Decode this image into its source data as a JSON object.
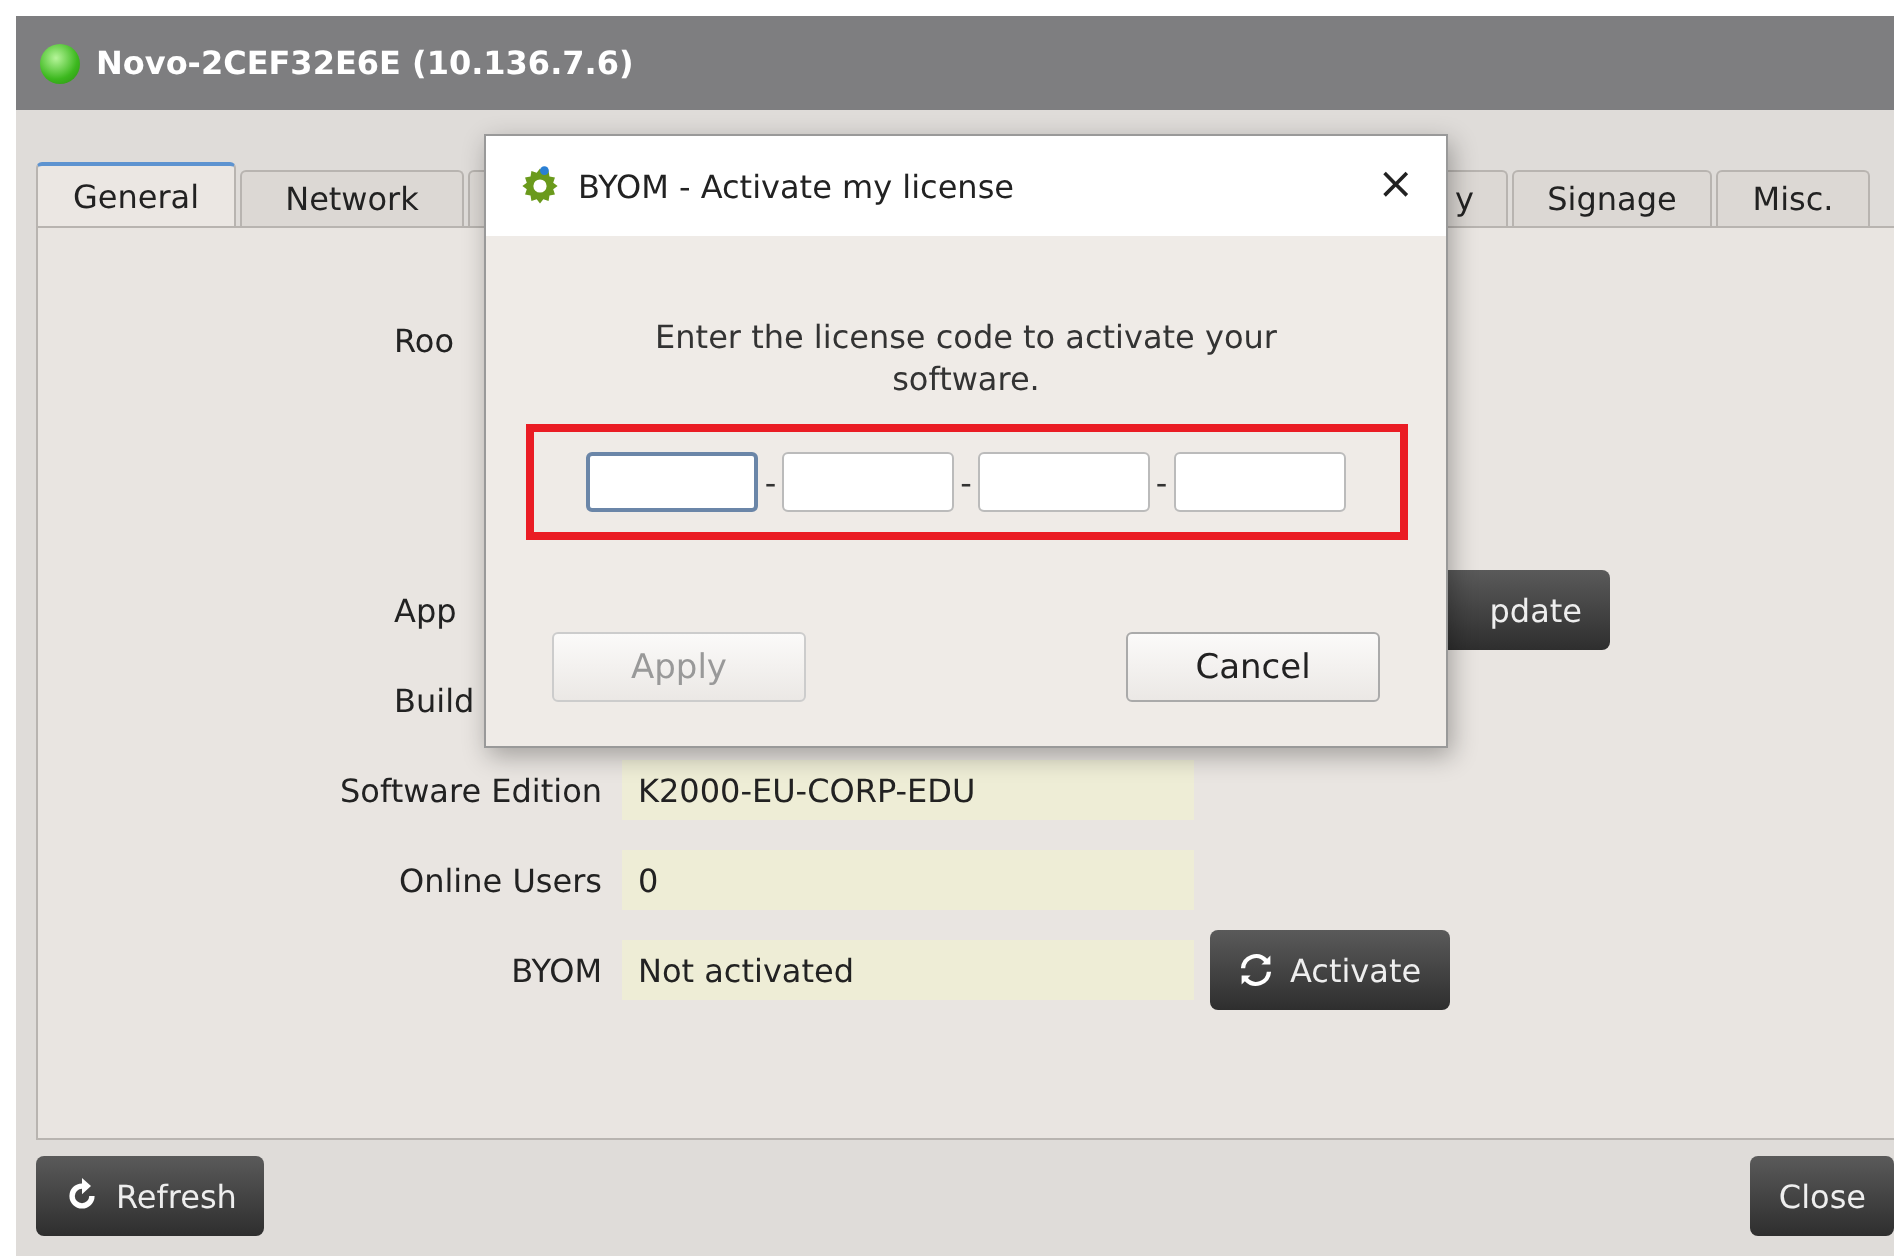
{
  "window": {
    "title": "Novo-2CEF32E6E (10.136.7.6)"
  },
  "tabs": [
    {
      "label": "General",
      "selected": true
    },
    {
      "label": "Network",
      "selected": false
    },
    {
      "label": "y",
      "selected": false
    },
    {
      "label": "Signage",
      "selected": false
    },
    {
      "label": "Misc.",
      "selected": false
    }
  ],
  "form": {
    "rows": [
      {
        "kind": "cut",
        "label": "Roo"
      },
      {
        "kind": "hidden"
      },
      {
        "kind": "hidden"
      },
      {
        "kind": "cut",
        "label": "App",
        "button": "pdate"
      },
      {
        "kind": "cut",
        "label": "Build"
      },
      {
        "kind": "full",
        "label": "Software Edition",
        "value": "K2000-EU-CORP-EDU"
      },
      {
        "kind": "full",
        "label": "Online Users",
        "value": "0"
      },
      {
        "kind": "full",
        "label": "BYOM",
        "value": "Not activated",
        "button": "Activate"
      }
    ]
  },
  "footer": {
    "refresh": "Refresh",
    "close": "Close"
  },
  "dialog": {
    "title": "BYOM - Activate my license",
    "close": "×",
    "message": "Enter the license code to activate your software.",
    "code_fields": [
      {
        "focused": true
      },
      {
        "focused": false
      },
      {
        "focused": false
      },
      {
        "focused": false
      }
    ],
    "separator": "-",
    "buttons": [
      {
        "label": "Apply",
        "disabled": true
      },
      {
        "label": "Cancel",
        "disabled": false
      }
    ]
  }
}
